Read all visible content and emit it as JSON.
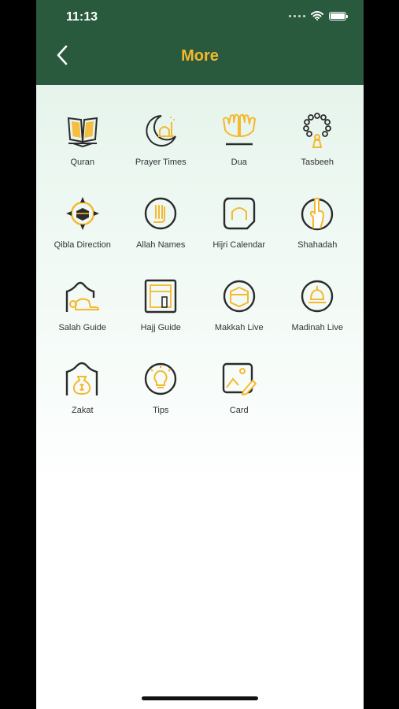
{
  "status_bar": {
    "time": "11:13"
  },
  "header": {
    "title": "More",
    "back_icon": "chevron-left-icon"
  },
  "colors": {
    "header_bg": "#2a5a3d",
    "accent": "#f5b82e",
    "dark": "#2b2b2b"
  },
  "items": [
    {
      "label": "Quran",
      "icon": "quran-icon"
    },
    {
      "label": "Prayer Times",
      "icon": "crescent-mosque-icon"
    },
    {
      "label": "Dua",
      "icon": "praying-hands-icon"
    },
    {
      "label": "Tasbeeh",
      "icon": "tasbeeh-beads-icon"
    },
    {
      "label": "Qibla Direction",
      "icon": "compass-kaaba-icon"
    },
    {
      "label": "Allah Names",
      "icon": "allah-names-icon"
    },
    {
      "label": "Hijri Calendar",
      "icon": "hijri-calendar-icon"
    },
    {
      "label": "Shahadah",
      "icon": "raised-finger-icon"
    },
    {
      "label": "Salah Guide",
      "icon": "prostrating-person-icon"
    },
    {
      "label": "Hajj Guide",
      "icon": "kaaba-frame-icon"
    },
    {
      "label": "Makkah Live",
      "icon": "kaaba-circle-icon"
    },
    {
      "label": "Madinah Live",
      "icon": "green-dome-icon"
    },
    {
      "label": "Zakat",
      "icon": "money-bag-icon"
    },
    {
      "label": "Tips",
      "icon": "lightbulb-icon"
    },
    {
      "label": "Card",
      "icon": "image-card-icon"
    }
  ]
}
